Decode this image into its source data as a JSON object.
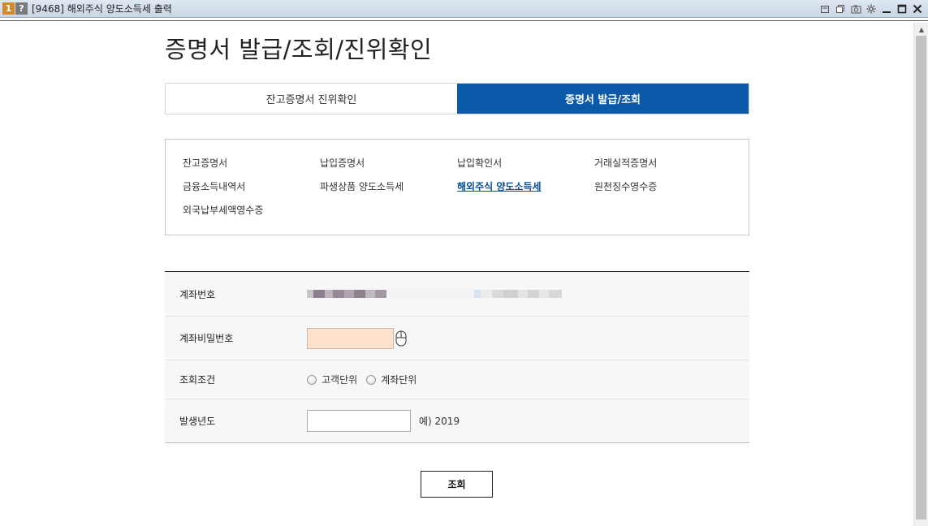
{
  "window": {
    "badge_number": "1",
    "badge_help": "?",
    "title": "[9468] 해외주식 양도소득세 출력"
  },
  "page": {
    "title": "증명서 발급/조회/진위확인"
  },
  "tabs": [
    {
      "label": "잔고증명서 진위확인",
      "active": false
    },
    {
      "label": "증명서 발급/조회",
      "active": true
    }
  ],
  "menu": {
    "items": [
      {
        "label": "잔고증명서",
        "current": false
      },
      {
        "label": "납입증명서",
        "current": false
      },
      {
        "label": "납입확인서",
        "current": false
      },
      {
        "label": "거래실적증명서",
        "current": false
      },
      {
        "label": "금융소득내역서",
        "current": false
      },
      {
        "label": "파생상품 양도소득세",
        "current": false
      },
      {
        "label": "해외주식 양도소득세",
        "current": true
      },
      {
        "label": "원천징수영수증",
        "current": false
      },
      {
        "label": "외국납부세액영수증",
        "current": false
      }
    ]
  },
  "form": {
    "account_label": "계좌번호",
    "password_label": "계좌비밀번호",
    "condition_label": "조회조건",
    "radio_customer": "고객단위",
    "radio_account": "계좌단위",
    "year_label": "발생년도",
    "year_value": "",
    "year_hint": "예) 2019"
  },
  "buttons": {
    "search": "조회"
  },
  "colors": {
    "accent": "#0a5aa9",
    "password_field": "#fde3cd"
  }
}
